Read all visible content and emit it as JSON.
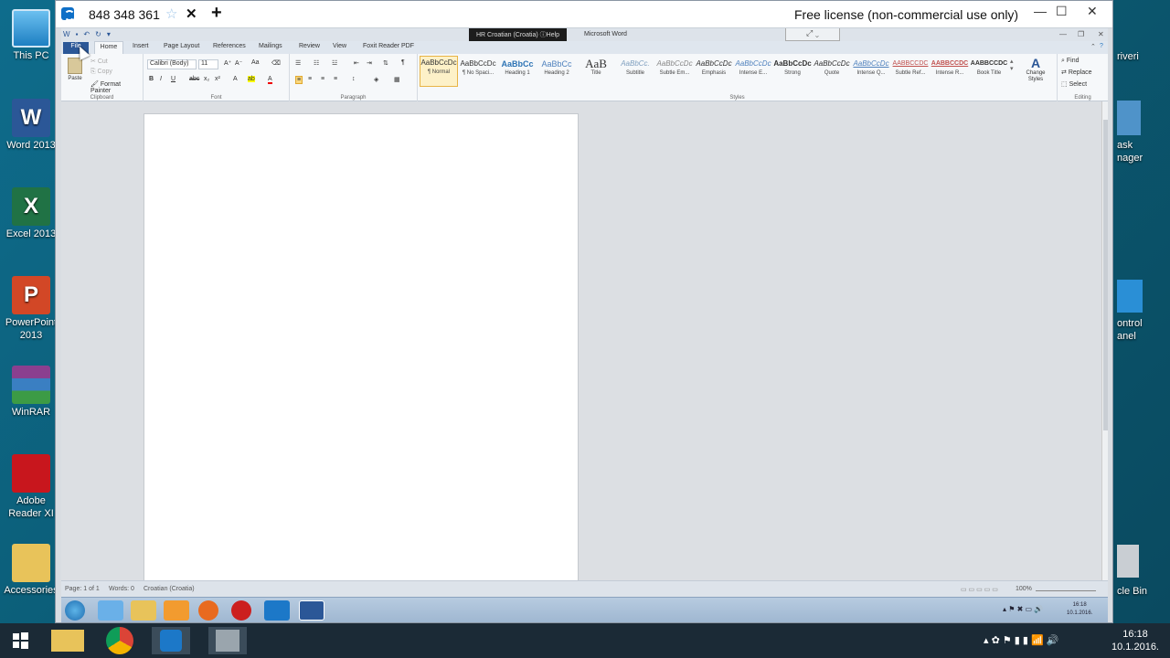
{
  "teamviewer": {
    "tab_title": "848 348 361",
    "license": "Free license (non-commercial use only)",
    "star": "☆",
    "close": "✕",
    "plus": "+",
    "minimize": "—",
    "maximize": "☐",
    "win_close": "✕"
  },
  "desktop_icons_left": [
    {
      "label": "This PC"
    },
    {
      "label": "Word 2013"
    },
    {
      "label": "Excel 2013"
    },
    {
      "label": "PowerPoint 2013"
    },
    {
      "label": "WinRAR"
    },
    {
      "label": "Adobe Reader XI"
    },
    {
      "label": "Accessories"
    }
  ],
  "desktop_icons_right": [
    {
      "label": "Drivers",
      "shown": "riveri"
    },
    {
      "label": "Task Manager",
      "shown": "ask\nnager"
    },
    {
      "label": "Control Panel",
      "shown": "ontrol\nanel"
    },
    {
      "label": "Recycle Bin",
      "shown": "cle Bin"
    }
  ],
  "word": {
    "app_title": "Microsoft Word",
    "language_bar": "HR Croatian (Croatia)",
    "help": "Help",
    "tabs": [
      "File",
      "Home",
      "Insert",
      "Page Layout",
      "References",
      "Mailings",
      "Review",
      "View",
      "Foxit Reader PDF"
    ],
    "clipboard": {
      "paste": "Paste",
      "cut": "Cut",
      "copy": "Copy",
      "format_painter": "Format Painter",
      "label": "Clipboard"
    },
    "font": {
      "name": "Calibri (Body)",
      "size": "11",
      "label": "Font"
    },
    "paragraph": {
      "label": "Paragraph"
    },
    "styles": [
      {
        "preview": "AaBbCcDc",
        "name": "¶ Normal"
      },
      {
        "preview": "AaBbCcDc",
        "name": "¶ No Spaci..."
      },
      {
        "preview": "AaBbCc",
        "name": "Heading 1"
      },
      {
        "preview": "AaBbCc",
        "name": "Heading 2"
      },
      {
        "preview": "AaB",
        "name": "Title"
      },
      {
        "preview": "AaBbCc.",
        "name": "Subtitle"
      },
      {
        "preview": "AaBbCcDc",
        "name": "Subtle Em..."
      },
      {
        "preview": "AaBbCcDc",
        "name": "Emphasis"
      },
      {
        "preview": "AaBbCcDc",
        "name": "Intense E..."
      },
      {
        "preview": "AaBbCcDc",
        "name": "Strong"
      },
      {
        "preview": "AaBbCcDc",
        "name": "Quote"
      },
      {
        "preview": "AaBbCcDc",
        "name": "Intense Q..."
      },
      {
        "preview": "AABBCCDC",
        "name": "Subtle Ref..."
      },
      {
        "preview": "AABBCCDC",
        "name": "Intense R..."
      },
      {
        "preview": "AABBCCDC",
        "name": "Book Title"
      }
    ],
    "styles_label": "Styles",
    "change_styles": "Change Styles",
    "editing": {
      "find": "Find",
      "replace": "Replace",
      "select": "Select",
      "label": "Editing"
    },
    "status": {
      "page": "Page: 1 of 1",
      "words": "Words: 0",
      "lang": "Croatian (Croatia)",
      "zoom": "100%"
    }
  },
  "remote_clock": {
    "time": "16:18",
    "date": "10.1.2016."
  },
  "local_clock": {
    "time": "16:18",
    "date": "10.1.2016."
  }
}
